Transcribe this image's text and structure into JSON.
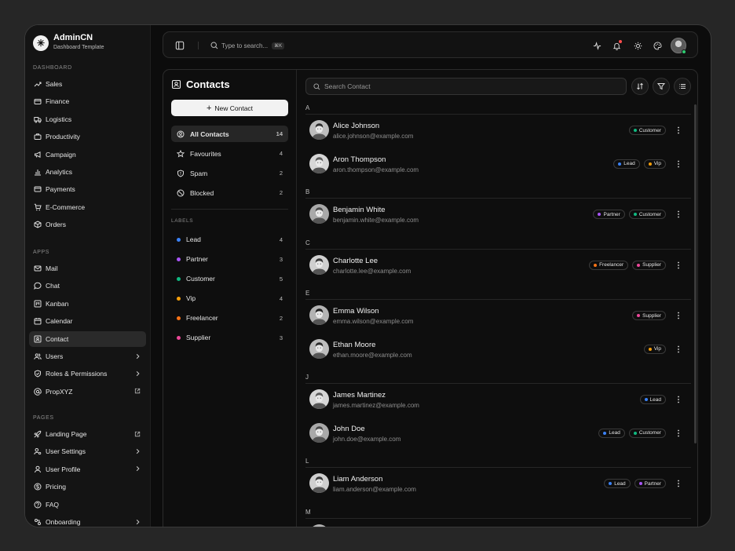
{
  "brand": {
    "title": "AdminCN",
    "subtitle": "Dashboard Template"
  },
  "sidebar": {
    "sections": {
      "dashboard": "DASHBOARD",
      "apps": "APPS",
      "pages": "PAGES"
    },
    "dashboard_items": [
      {
        "label": "Sales",
        "icon": "trending-up-icon"
      },
      {
        "label": "Finance",
        "icon": "wallet-icon"
      },
      {
        "label": "Logistics",
        "icon": "truck-icon"
      },
      {
        "label": "Productivity",
        "icon": "briefcase-icon"
      },
      {
        "label": "Campaign",
        "icon": "megaphone-icon"
      },
      {
        "label": "Analytics",
        "icon": "bar-chart-icon"
      },
      {
        "label": "Payments",
        "icon": "credit-card-icon"
      },
      {
        "label": "E-Commerce",
        "icon": "cart-icon"
      },
      {
        "label": "Orders",
        "icon": "package-icon"
      }
    ],
    "apps_items": [
      {
        "label": "Mail",
        "icon": "mail-icon"
      },
      {
        "label": "Chat",
        "icon": "chat-icon"
      },
      {
        "label": "Kanban",
        "icon": "kanban-icon"
      },
      {
        "label": "Calendar",
        "icon": "calendar-icon"
      },
      {
        "label": "Contact",
        "icon": "contact-icon",
        "active": true
      },
      {
        "label": "Users",
        "icon": "users-icon",
        "right": "chevron-right-icon"
      },
      {
        "label": "Roles & Permissions",
        "icon": "shield-icon",
        "right": "chevron-right-icon"
      },
      {
        "label": "PropXYZ",
        "icon": "at-icon",
        "right": "external-link-icon"
      }
    ],
    "pages_items": [
      {
        "label": "Landing Page",
        "icon": "rocket-icon",
        "right": "external-link-icon"
      },
      {
        "label": "User Settings",
        "icon": "user-cog-icon",
        "right": "chevron-right-icon"
      },
      {
        "label": "User Profile",
        "icon": "user-icon",
        "right": "chevron-right-icon"
      },
      {
        "label": "Pricing",
        "icon": "dollar-icon"
      },
      {
        "label": "FAQ",
        "icon": "help-icon"
      },
      {
        "label": "Onboarding",
        "icon": "onboarding-icon",
        "right": "chevron-right-icon"
      }
    ]
  },
  "topbar": {
    "search_placeholder": "Type to search...",
    "shortcut": "⌘K"
  },
  "contacts": {
    "title": "Contacts",
    "new_button": "New Contact",
    "filters": [
      {
        "label": "All Contacts",
        "count": "14",
        "icon": "user-circle-icon",
        "active": true
      },
      {
        "label": "Favourites",
        "count": "4",
        "icon": "star-icon"
      },
      {
        "label": "Spam",
        "count": "2",
        "icon": "shield-alert-icon"
      },
      {
        "label": "Blocked",
        "count": "2",
        "icon": "ban-icon"
      }
    ],
    "labels_title": "LABELS",
    "labels": [
      {
        "label": "Lead",
        "count": "4",
        "color": "#3b82f6"
      },
      {
        "label": "Partner",
        "count": "3",
        "color": "#a855f7"
      },
      {
        "label": "Customer",
        "count": "5",
        "color": "#10b981"
      },
      {
        "label": "Vip",
        "count": "4",
        "color": "#f59e0b"
      },
      {
        "label": "Freelancer",
        "count": "2",
        "color": "#f97316"
      },
      {
        "label": "Supplier",
        "count": "3",
        "color": "#ec4899"
      }
    ],
    "search_placeholder": "Search Contact"
  },
  "tag_colors": {
    "Lead": "#3b82f6",
    "Partner": "#a855f7",
    "Customer": "#10b981",
    "Vip": "#f59e0b",
    "Freelancer": "#f97316",
    "Supplier": "#ec4899"
  },
  "groups": [
    {
      "letter": "A",
      "contacts": [
        {
          "name": "Alice Johnson",
          "email": "alice.johnson@example.com",
          "tags": [
            "Customer"
          ]
        },
        {
          "name": "Aron Thompson",
          "email": "aron.thompson@example.com",
          "tags": [
            "Lead",
            "Vip"
          ]
        }
      ]
    },
    {
      "letter": "B",
      "contacts": [
        {
          "name": "Benjamin White",
          "email": "benjamin.white@example.com",
          "tags": [
            "Partner",
            "Customer"
          ]
        }
      ]
    },
    {
      "letter": "C",
      "contacts": [
        {
          "name": "Charlotte Lee",
          "email": "charlotte.lee@example.com",
          "tags": [
            "Freelancer",
            "Supplier"
          ]
        }
      ]
    },
    {
      "letter": "E",
      "contacts": [
        {
          "name": "Emma Wilson",
          "email": "emma.wilson@example.com",
          "tags": [
            "Supplier"
          ]
        },
        {
          "name": "Ethan Moore",
          "email": "ethan.moore@example.com",
          "tags": [
            "Vip"
          ]
        }
      ]
    },
    {
      "letter": "J",
      "contacts": [
        {
          "name": "James Martinez",
          "email": "james.martinez@example.com",
          "tags": [
            "Lead"
          ]
        },
        {
          "name": "John Doe",
          "email": "john.doe@example.com",
          "tags": [
            "Lead",
            "Customer"
          ]
        }
      ]
    },
    {
      "letter": "L",
      "contacts": [
        {
          "name": "Liam Anderson",
          "email": "liam.anderson@example.com",
          "tags": [
            "Lead",
            "Partner"
          ]
        }
      ]
    },
    {
      "letter": "M",
      "contacts": []
    }
  ]
}
